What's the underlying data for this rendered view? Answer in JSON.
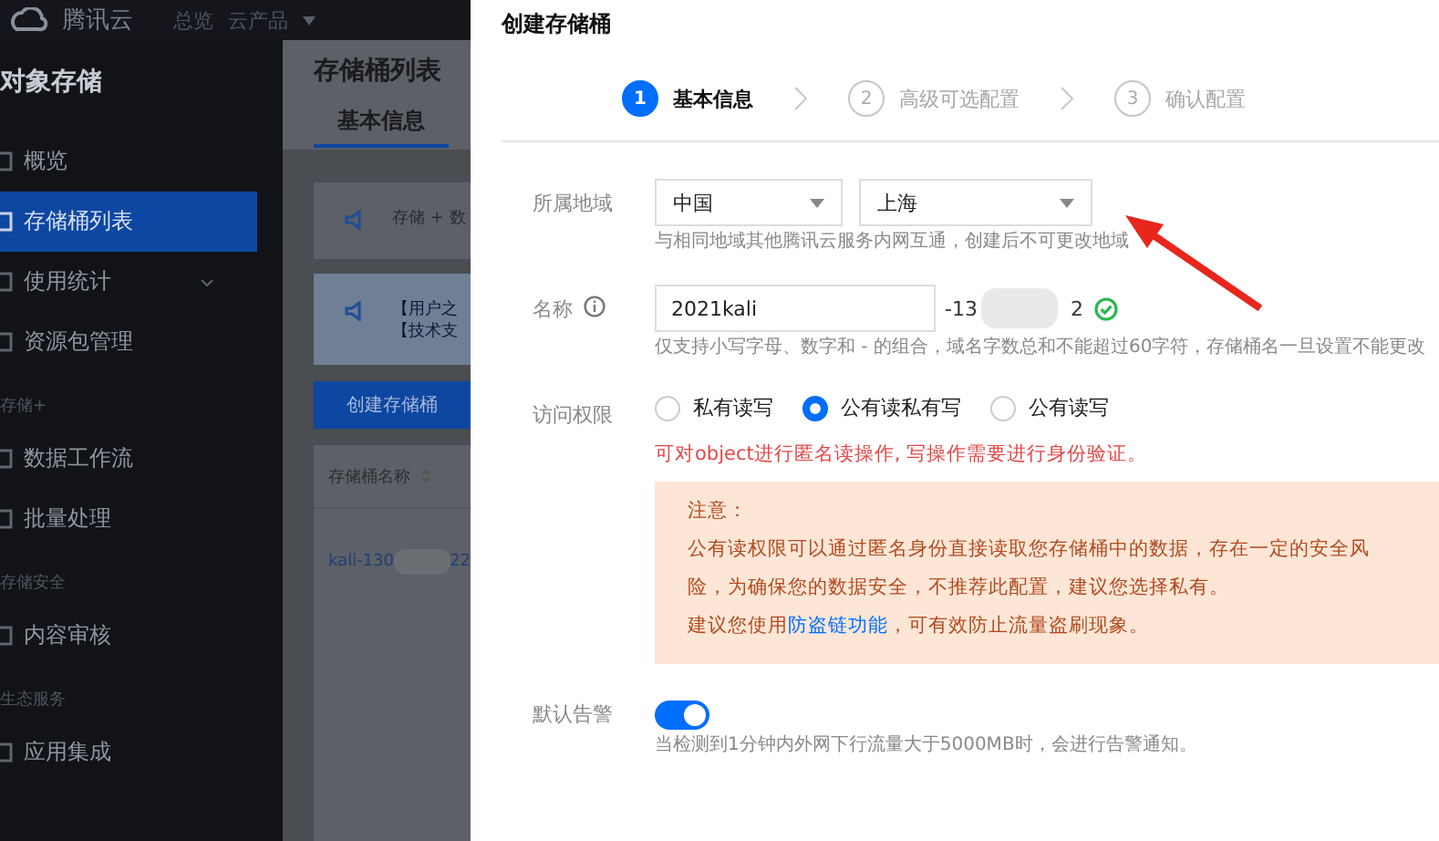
{
  "top_bar": {
    "logo": "腾讯云",
    "nav": [
      "总览",
      "云产品"
    ]
  },
  "sidebar": {
    "title": "对象存储",
    "items": [
      {
        "kind": "item",
        "label": "概览",
        "selected": false
      },
      {
        "kind": "item",
        "label": "存储桶列表",
        "selected": true
      },
      {
        "kind": "submenu",
        "label": "使用统计",
        "selected": false
      },
      {
        "kind": "item",
        "label": "资源包管理",
        "selected": false
      },
      {
        "kind": "group",
        "label": "存储+"
      },
      {
        "kind": "item",
        "label": "数据工作流",
        "selected": false
      },
      {
        "kind": "item",
        "label": "批量处理",
        "selected": false
      },
      {
        "kind": "group",
        "label": "存储安全"
      },
      {
        "kind": "item",
        "label": "内容审核",
        "selected": false
      },
      {
        "kind": "group",
        "label": "生态服务"
      },
      {
        "kind": "item",
        "label": "应用集成",
        "selected": false
      }
    ]
  },
  "main": {
    "title": "存储桶列表",
    "tabs": [
      {
        "label": "基本信息",
        "selected": true
      }
    ],
    "notices": [
      {
        "lines": [
          "存储 + 数"
        ]
      },
      {
        "lines": [
          "【用户之",
          "【技术支"
        ]
      }
    ],
    "create_button": "创建存储桶",
    "table": {
      "columns": [
        "存储桶名称"
      ],
      "rows": [
        {
          "name_start": "kali-130",
          "name_end": "22"
        }
      ]
    }
  },
  "drawer": {
    "title": "创建存储桶",
    "steps": [
      {
        "number": "1",
        "label": "基本信息",
        "selected": true
      },
      {
        "number": "2",
        "label": "高级可选配置",
        "selected": false
      },
      {
        "number": "3",
        "label": "确认配置",
        "selected": false
      }
    ],
    "region": {
      "label": "所属地域",
      "selects": [
        {
          "value": "中国"
        },
        {
          "value": "上海"
        }
      ],
      "hint": "与相同地域其他腾讯云服务内网互通，创建后不可更改地域"
    },
    "name": {
      "label": "名称",
      "value": "2021kali",
      "suffix_start": "-13",
      "suffix_end": "2",
      "valid": true,
      "hint": "仅支持小写字母、数字和 - 的组合，域名字数总和不能超过60字符，存储桶名一旦设置不能更改"
    },
    "access": {
      "label": "访问权限",
      "options": [
        {
          "label": "私有读写",
          "selected": false
        },
        {
          "label": "公有读私有写",
          "selected": true
        },
        {
          "label": "公有读写",
          "selected": false
        }
      ],
      "warning": "可对object进行匿名读操作, 写操作需要进行身份验证。"
    },
    "notice": {
      "title": "注意：",
      "text": "公有读权限可以通过匿名身份直接读取您存储桶中的数据，存在一定的安全风险，为确保您的数据安全，不推荐此配置，建议您选择私有。",
      "advice_before": "建议您使用",
      "advice_link": "防盗链功能",
      "advice_after": "，可有效防止流量盗刷现象。"
    },
    "alarm": {
      "label": "默认告警",
      "on": true,
      "hint": "当检测到1分钟内外网下行流量大于5000MB时，会进行告警通知。"
    }
  }
}
